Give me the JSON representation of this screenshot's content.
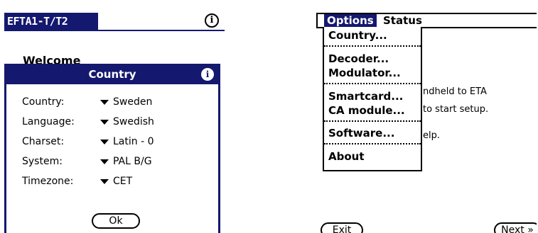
{
  "left": {
    "title": "EFTA1-T/T2",
    "info_glyph": "i",
    "welcome": "Welcome",
    "dialog": {
      "title": "Country",
      "info_glyph": "i",
      "fields": [
        {
          "label": "Country:",
          "value": "Sweden"
        },
        {
          "label": "Language:",
          "value": "Swedish"
        },
        {
          "label": "Charset:",
          "value": "Latin - 0"
        },
        {
          "label": "System:",
          "value": "PAL B/G"
        },
        {
          "label": "Timezone:",
          "value": "CET"
        }
      ],
      "ok_label": "Ok"
    }
  },
  "right": {
    "menu": {
      "options": "Options",
      "status": "Status",
      "items": [
        "Country...",
        "Decoder...",
        "Modulator...",
        "Smartcard...",
        "CA module...",
        "Software...",
        "About"
      ]
    },
    "background_text": [
      "ndheld to ETA",
      "to start setup.",
      "elp."
    ],
    "exit_label": "Exit",
    "next_label": "Next »"
  },
  "colors": {
    "accent": "#14186e"
  }
}
